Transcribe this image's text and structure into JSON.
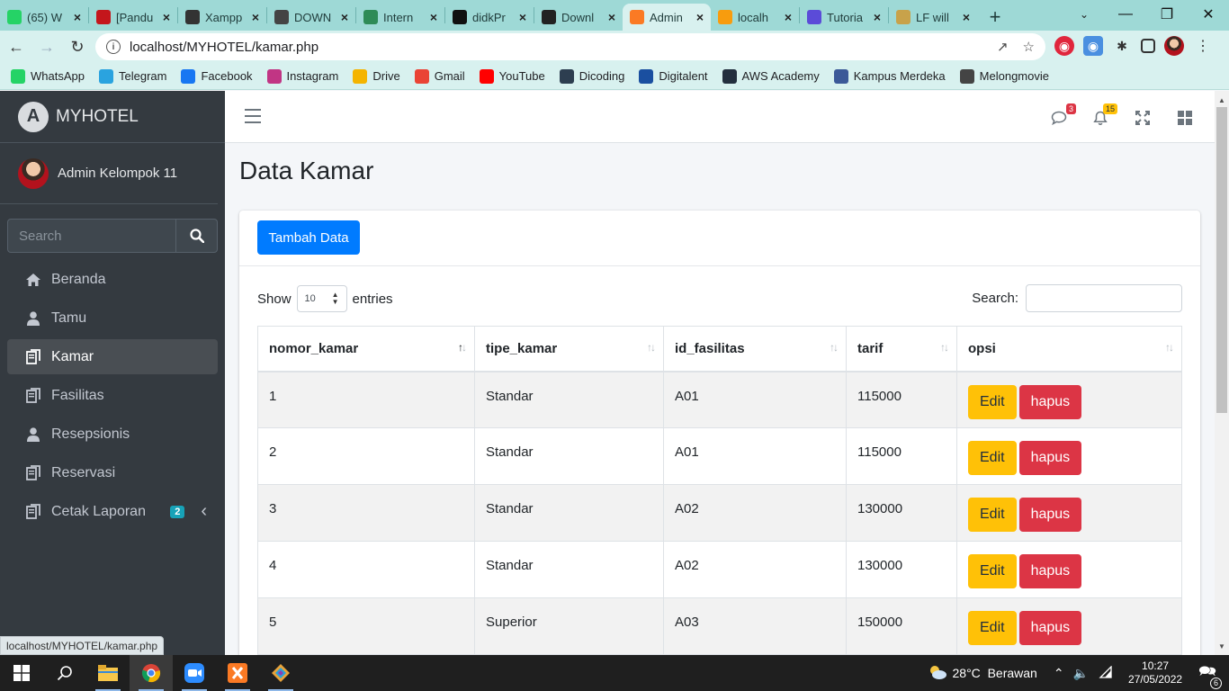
{
  "browser": {
    "tabs": [
      {
        "label": "(65) W",
        "icon": "whatsapp-icon",
        "color": "#25d366"
      },
      {
        "label": "[Pandu",
        "icon": "pandu-icon",
        "color": "#c4161c"
      },
      {
        "label": "Xampp",
        "icon": "xampp-web-icon",
        "color": "#333333"
      },
      {
        "label": "DOWN",
        "icon": "download-site-icon",
        "color": "#444444"
      },
      {
        "label": "Intern",
        "icon": "internet-icon",
        "color": "#2e8b57"
      },
      {
        "label": "didkPr",
        "icon": "github-icon",
        "color": "#111111"
      },
      {
        "label": "Downl",
        "icon": "download-icon",
        "color": "#222222"
      },
      {
        "label": "Admin",
        "icon": "xampp-icon",
        "color": "#fb7a24",
        "active": true
      },
      {
        "label": "localh",
        "icon": "phpmyadmin-icon",
        "color": "#f89c0e"
      },
      {
        "label": "Tutoria",
        "icon": "tutorial-icon",
        "color": "#5b4bd8"
      },
      {
        "label": "LF will",
        "icon": "lf-icon",
        "color": "#c8a24a"
      }
    ],
    "url": "localhost/MYHOTEL/kamar.php",
    "bookmarks": [
      {
        "label": "WhatsApp",
        "icon": "whatsapp-icon",
        "color": "#25d366"
      },
      {
        "label": "Telegram",
        "icon": "telegram-icon",
        "color": "#2aa3df"
      },
      {
        "label": "Facebook",
        "icon": "facebook-icon",
        "color": "#1877f2"
      },
      {
        "label": "Instagram",
        "icon": "instagram-icon",
        "color": "#c13584"
      },
      {
        "label": "Drive",
        "icon": "drive-icon",
        "color": "#f4b400"
      },
      {
        "label": "Gmail",
        "icon": "gmail-icon",
        "color": "#ea4335"
      },
      {
        "label": "YouTube",
        "icon": "youtube-icon",
        "color": "#ff0000"
      },
      {
        "label": "Dicoding",
        "icon": "dicoding-icon",
        "color": "#2d3e50"
      },
      {
        "label": "Digitalent",
        "icon": "digitalent-icon",
        "color": "#1a4fa0"
      },
      {
        "label": "AWS Academy",
        "icon": "aws-icon",
        "color": "#232f3e"
      },
      {
        "label": "Kampus Merdeka",
        "icon": "kampus-merdeka-icon",
        "color": "#3b5998"
      },
      {
        "label": "Melongmovie",
        "icon": "melongmovie-icon",
        "color": "#444444"
      }
    ],
    "status_url": "localhost/MYHOTEL/kamar.php"
  },
  "sidebar": {
    "brand": "MYHOTEL",
    "brand_logo": "A",
    "user": "Admin Kelompok 11",
    "search_placeholder": "Search",
    "items": [
      {
        "label": "Beranda",
        "icon": "home-icon"
      },
      {
        "label": "Tamu",
        "icon": "user-icon"
      },
      {
        "label": "Kamar",
        "icon": "copy-icon",
        "active": true
      },
      {
        "label": "Fasilitas",
        "icon": "copy-icon"
      },
      {
        "label": "Resepsionis",
        "icon": "user-icon"
      },
      {
        "label": "Reservasi",
        "icon": "copy-icon"
      },
      {
        "label": "Cetak Laporan",
        "icon": "copy-icon",
        "badge": "2"
      }
    ]
  },
  "topnav": {
    "messages_count": "3",
    "notifications_count": "15"
  },
  "page": {
    "title": "Data Kamar",
    "add_button": "Tambah Data",
    "show_label": "Show",
    "entries_value": "10",
    "entries_label": "entries",
    "search_label": "Search:"
  },
  "table": {
    "columns": [
      "nomor_kamar",
      "tipe_kamar",
      "id_fasilitas",
      "tarif",
      "opsi"
    ],
    "rows": [
      {
        "nomor_kamar": "1",
        "tipe_kamar": "Standar",
        "id_fasilitas": "A01",
        "tarif": "115000"
      },
      {
        "nomor_kamar": "2",
        "tipe_kamar": "Standar",
        "id_fasilitas": "A01",
        "tarif": "115000"
      },
      {
        "nomor_kamar": "3",
        "tipe_kamar": "Standar",
        "id_fasilitas": "A02",
        "tarif": "130000"
      },
      {
        "nomor_kamar": "4",
        "tipe_kamar": "Standar",
        "id_fasilitas": "A02",
        "tarif": "130000"
      },
      {
        "nomor_kamar": "5",
        "tipe_kamar": "Superior",
        "id_fasilitas": "A03",
        "tarif": "150000"
      }
    ],
    "edit_label": "Edit",
    "delete_label": "hapus"
  },
  "taskbar": {
    "weather": "28°C  Berawan",
    "time": "10:27",
    "date": "27/05/2022",
    "notification_count": "6"
  }
}
